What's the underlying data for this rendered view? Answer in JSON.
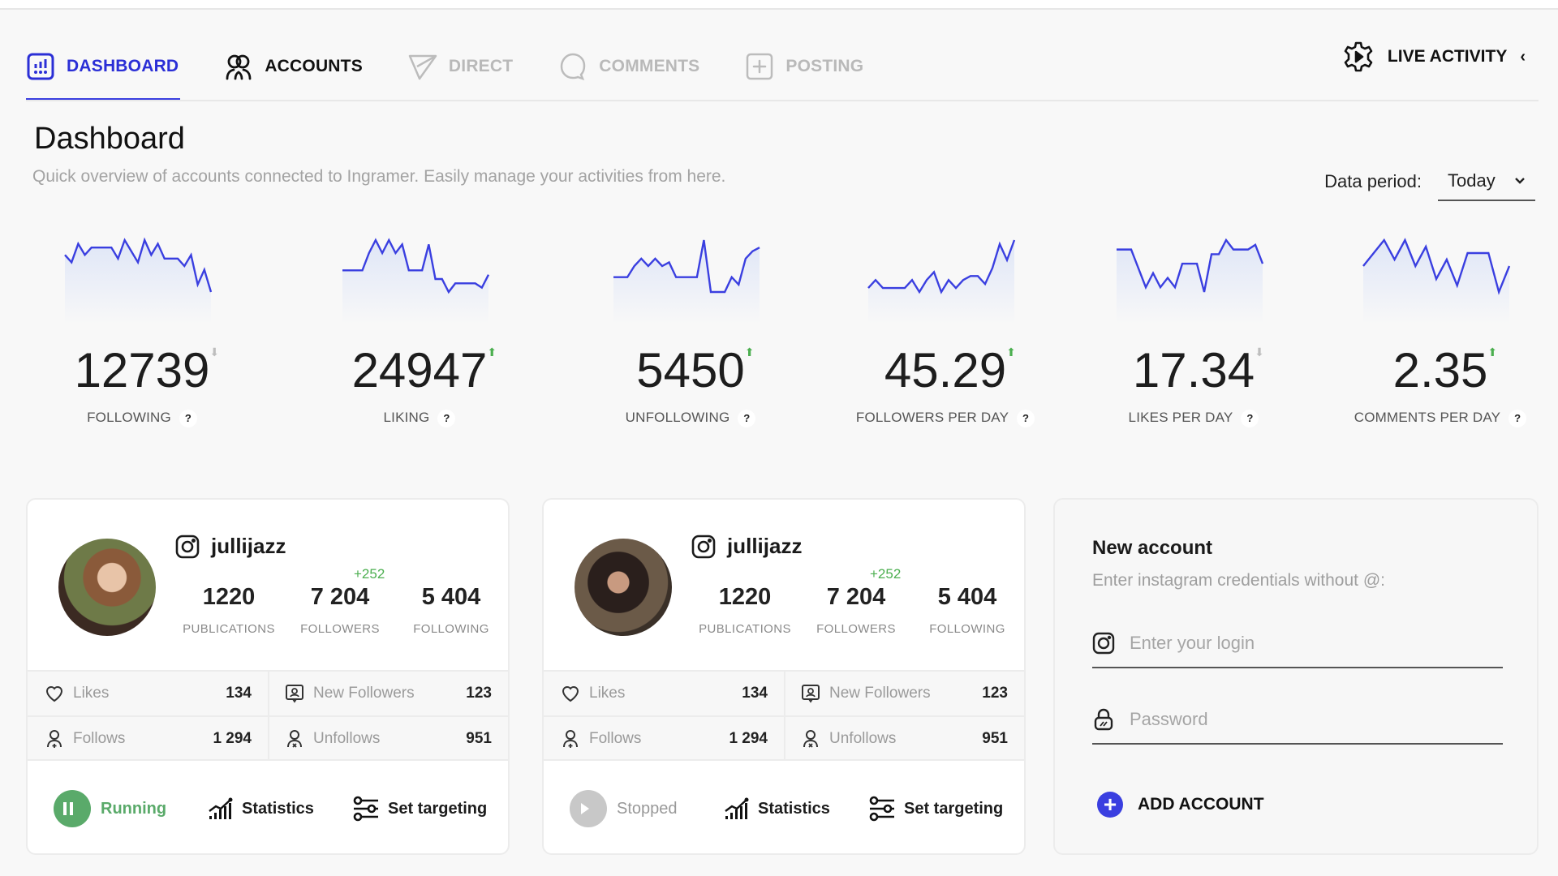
{
  "nav": {
    "items": [
      {
        "label": "DASHBOARD",
        "icon": "dashboard-icon",
        "state": "active"
      },
      {
        "label": "ACCOUNTS",
        "icon": "users-icon",
        "state": "normal"
      },
      {
        "label": "DIRECT",
        "icon": "send-icon",
        "state": "disabled"
      },
      {
        "label": "COMMENTS",
        "icon": "comment-icon",
        "state": "disabled"
      },
      {
        "label": "POSTING",
        "icon": "plus-square-icon",
        "state": "disabled"
      }
    ],
    "live_activity": {
      "label": "LIVE ACTIVITY",
      "icon": "gear-play-icon",
      "chevron": "‹"
    }
  },
  "header": {
    "title": "Dashboard",
    "subtitle": "Quick overview of accounts connected to Ingramer. Easily manage your activities from here.",
    "period_label": "Data period:",
    "period_value": "Today"
  },
  "colors": {
    "accent": "#3a3fe0",
    "up": "#4caf50",
    "down": "#bdbdbd",
    "running": "#5aaa6a",
    "stopped": "#c8c8c8"
  },
  "metrics": [
    {
      "value": "12739",
      "label": "FOLLOWING",
      "trend": "down",
      "spark": [
        6,
        4,
        9,
        6,
        8,
        8,
        8,
        8,
        5,
        10,
        7,
        4,
        10,
        6,
        9,
        5,
        5,
        5,
        3,
        6,
        -2,
        2,
        -4
      ]
    },
    {
      "value": "24947",
      "label": "LIKING",
      "trend": "up",
      "spark": [
        3,
        3,
        3,
        3,
        7,
        10,
        7,
        10,
        7,
        9,
        3,
        3,
        3,
        9,
        1,
        1,
        -2,
        0,
        0,
        0,
        0,
        -1,
        2
      ]
    },
    {
      "value": "5450",
      "label": "UNFOLLOWING",
      "trend": "up",
      "spark": [
        3,
        3,
        3,
        6,
        8,
        6,
        8,
        6,
        7,
        3,
        3,
        3,
        3,
        13,
        -1,
        -1,
        -1,
        3,
        1,
        8,
        10,
        11
      ]
    },
    {
      "value": "45.29",
      "label": "FOLLOWERS PER DAY",
      "trend": "up",
      "spark": [
        3,
        5,
        3,
        3,
        3,
        3,
        5,
        2,
        5,
        7,
        2,
        5,
        3,
        5,
        6,
        6,
        4,
        8,
        14,
        10,
        15
      ]
    },
    {
      "value": "17.34",
      "label": "LIKES PER DAY",
      "trend": "down",
      "spark": [
        9,
        9,
        9,
        5,
        1,
        4,
        1,
        3,
        1,
        6,
        6,
        6,
        0,
        8,
        8,
        11,
        9,
        9,
        9,
        10,
        6
      ]
    },
    {
      "value": "2.35",
      "label": "COMMENTS PER DAY",
      "trend": "up",
      "spark": [
        6,
        8,
        10,
        7,
        10,
        6,
        9,
        4,
        7,
        3,
        8,
        8,
        8,
        2,
        6
      ]
    }
  ],
  "accounts": [
    {
      "username": "jullijazz",
      "followers_delta": "+252",
      "stats": [
        {
          "value": "1220",
          "label": "PUBLICATIONS"
        },
        {
          "value": "7 204",
          "label": "FOLLOWERS"
        },
        {
          "value": "5 404",
          "label": "FOLLOWING"
        }
      ],
      "grid": [
        {
          "label": "Likes",
          "value": "134",
          "icon": "heart-icon"
        },
        {
          "label": "New Followers",
          "value": "123",
          "icon": "new-follower-icon"
        },
        {
          "label": "Follows",
          "value": "1 294",
          "icon": "user-plus-icon"
        },
        {
          "label": "Unfollows",
          "value": "951",
          "icon": "user-remove-icon"
        }
      ],
      "status": "Running",
      "statistics_label": "Statistics",
      "targeting_label": "Set targeting"
    },
    {
      "username": "jullijazz",
      "followers_delta": "+252",
      "stats": [
        {
          "value": "1220",
          "label": "PUBLICATIONS"
        },
        {
          "value": "7 204",
          "label": "FOLLOWERS"
        },
        {
          "value": "5 404",
          "label": "FOLLOWING"
        }
      ],
      "grid": [
        {
          "label": "Likes",
          "value": "134",
          "icon": "heart-icon"
        },
        {
          "label": "New Followers",
          "value": "123",
          "icon": "new-follower-icon"
        },
        {
          "label": "Follows",
          "value": "1 294",
          "icon": "user-plus-icon"
        },
        {
          "label": "Unfollows",
          "value": "951",
          "icon": "user-remove-icon"
        }
      ],
      "status": "Stopped",
      "statistics_label": "Statistics",
      "targeting_label": "Set targeting"
    }
  ],
  "new_account": {
    "title": "New account",
    "subtitle": "Enter instagram credentials without @:",
    "login_placeholder": "Enter your login",
    "login_value": "",
    "password_placeholder": "Password",
    "password_value": "",
    "button_label": "ADD ACCOUNT"
  }
}
